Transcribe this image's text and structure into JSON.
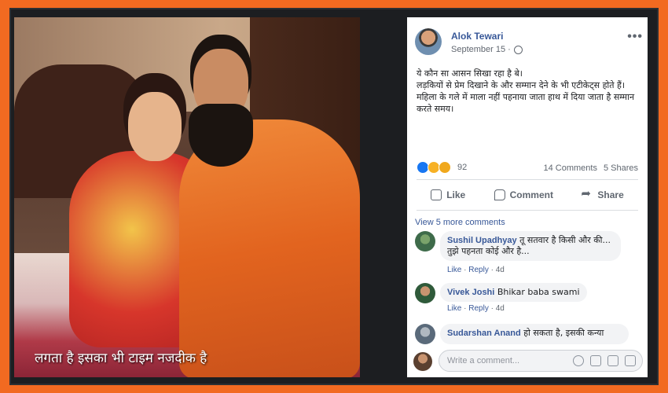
{
  "photo": {
    "caption": "लगता है इसका भी टाइम नजदीक है"
  },
  "post": {
    "author": "Alok Tewari",
    "date": "September 15 ·",
    "text_lines": [
      "ये कौन सा आसन सिखा रहा है बे।",
      "लड़कियों से प्रेम दिखाने के और सम्मान देने के भी एटीकेट्स होते हैं।",
      "महिला के गले में माला नहीं पहनाया जाता हाथ में दिया जाता है सम्मान करते समय।"
    ],
    "reaction_count": "92",
    "comments_count": "14 Comments",
    "shares_count": "5 Shares",
    "actions": {
      "like": "Like",
      "comment": "Comment",
      "share": "Share"
    },
    "view_more": "View 5 more comments",
    "comments": [
      {
        "name": "Sushil Upadhyay",
        "text": "तू सतवार है किसी और की... तुझे पहनता कोई और है...",
        "like": "Like",
        "reply": "Reply",
        "age": "4d"
      },
      {
        "name": "Vivek Joshi",
        "text": "Bhikar baba swami",
        "like": "Like",
        "reply": "Reply",
        "age": "4d"
      },
      {
        "name": "Sudarshan Anand",
        "text": "हो सकता है, इसकी कन्या",
        "like": "",
        "reply": "",
        "age": ""
      }
    ],
    "write_placeholder": "Write a comment..."
  },
  "colors": {
    "border": "#f26a21",
    "link": "#385898",
    "like_blue": "#1877f2"
  },
  "icons": [
    "globe-icon",
    "more-icon",
    "like-icon",
    "comment-icon",
    "share-icon",
    "emoji-icon",
    "camera-icon",
    "gif-icon",
    "sticker-icon"
  ]
}
